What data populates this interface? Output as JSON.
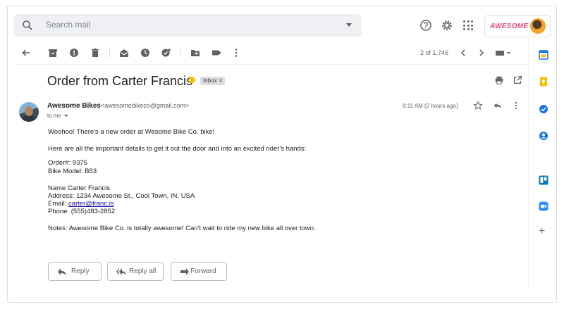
{
  "search": {
    "placeholder": "Search mail"
  },
  "header": {
    "brand_logo": "AWESOME"
  },
  "toolbar": {
    "count": "2 of 1,746"
  },
  "email": {
    "subject": "Order from Carter Francis",
    "label": "Inbox",
    "label_close": "×",
    "from_name": "Awesome Bikes",
    "from_email": "<awesomebikeco@gmail.com>",
    "to": "to me",
    "time": "8:11 AM (2 hours ago)",
    "body": {
      "greeting": "Woohoo! There's a new order at Wesome Bike Co. bike!",
      "intro": "Here are all the important details to get it out the door and into an excited rider's hands:",
      "order_line": "Order#: 9375",
      "model_line": "Bike Model: B53",
      "name_line": "Name Carter Francis",
      "address_line": "Address: 1234 Awesome St., Cool Town, IN, USA",
      "email_prefix": "Email: ",
      "email_link": "carter@franc.is",
      "phone_line": "Phone: (555)483-2852",
      "notes": "Notes: Awesome Bike Co. is totally awesome! Can't wait to ride my new bike all over town."
    }
  },
  "actions": {
    "reply": "Reply",
    "reply_all": "Reply all",
    "forward": "Forward"
  },
  "colors": {
    "calendar": "#1a73e8",
    "keep": "#fbbc04",
    "tasks": "#1a73e8",
    "contacts": "#1a73e8",
    "trello": "#0079bf",
    "zoom": "#2d8cff",
    "important": "#f4c20d",
    "brand": "#e8477a"
  },
  "icons": [
    "search-icon",
    "help-icon",
    "settings-icon",
    "apps-icon",
    "back-icon",
    "archive-icon",
    "report-spam-icon",
    "delete-icon",
    "mark-unread-icon",
    "snooze-icon",
    "add-task-icon",
    "move-to-icon",
    "labels-icon",
    "more-icon",
    "prev-icon",
    "next-icon",
    "input-tools-icon",
    "print-icon",
    "open-new-window-icon",
    "star-icon",
    "reply-icon",
    "calendar-icon",
    "keep-icon",
    "tasks-icon",
    "contacts-icon",
    "trello-icon",
    "zoom-icon",
    "add-addon-icon"
  ]
}
